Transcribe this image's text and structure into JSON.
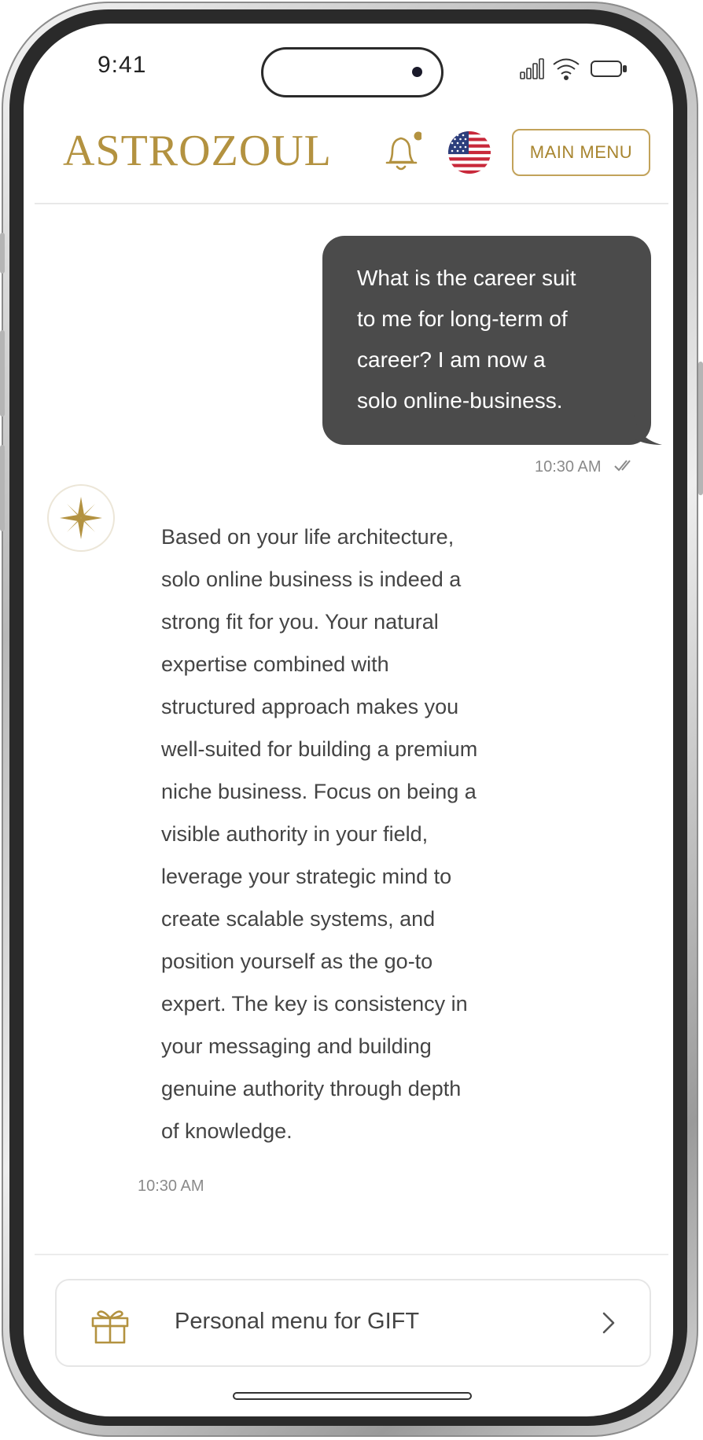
{
  "status_bar": {
    "time": "9:41"
  },
  "header": {
    "logo": "ASTROZOUL",
    "main_menu_label": "MAIN MENU",
    "bell_icon": "bell-icon",
    "flag_icon": "us-flag-icon"
  },
  "chat": {
    "user_message": {
      "lines": [
        "What is the career suit",
        "to me for long-term of",
        "career? I am now a",
        "solo online-business."
      ],
      "time": "10:30 AM"
    },
    "assistant_message": {
      "lines": [
        "Based on your life architecture,",
        "solo online business is indeed a",
        "strong fit for you. Your natural",
        "expertise combined with",
        "structured approach makes you",
        "well-suited for building a premium",
        "niche business. Focus on being a",
        "visible authority in your field,",
        "leverage your strategic mind to",
        "create scalable systems, and",
        "position yourself as the go-to",
        "expert. The key is consistency in",
        "your messaging and building",
        "genuine authority through depth",
        "of knowledge."
      ],
      "time": "10:30 AM"
    }
  },
  "footer": {
    "gift_label": "Personal menu for GIFT"
  },
  "colors": {
    "accent": "#b39240",
    "bubble": "#4b4b4b"
  }
}
